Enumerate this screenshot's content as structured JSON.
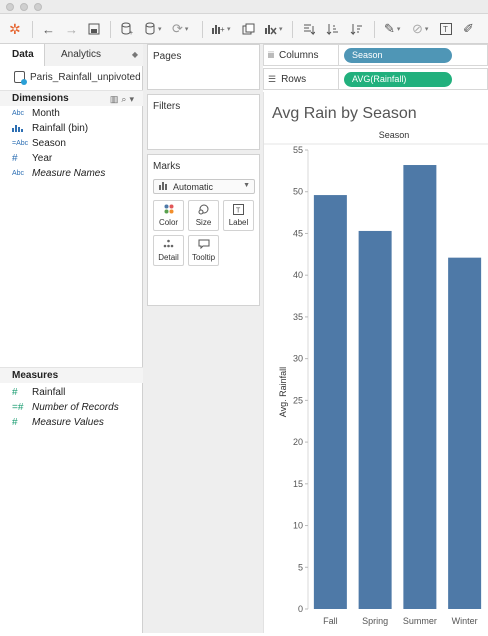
{
  "colors": {
    "bar": "#4e79a7",
    "columns_pill": "#4f96b6",
    "rows_pill": "#22b07d"
  },
  "toolbar": {
    "icons": [
      "tableau-logo-icon",
      "back-arrow-icon",
      "forward-arrow-icon",
      "save-icon",
      "new-datasource-icon",
      "pause-datasource-icon",
      "refresh-icon",
      "new-worksheet-icon",
      "duplicate-sheet-icon",
      "clear-sheet-icon",
      "swap-axes-icon",
      "sort-ascending-icon",
      "sort-descending-icon",
      "highlight-icon",
      "group-icon",
      "text-label-icon",
      "pin-icon"
    ]
  },
  "left_panel": {
    "tabs": {
      "data": "Data",
      "analytics": "Analytics"
    },
    "datasource": "Paris_Rainfall_unpivoted",
    "dimensions_title": "Dimensions",
    "dimensions": [
      {
        "type": "Abc",
        "name": "Month"
      },
      {
        "type": "bin",
        "name": "Rainfall (bin)"
      },
      {
        "type": "=Abc",
        "name": "Season"
      },
      {
        "type": "#",
        "name": "Year"
      },
      {
        "type": "Abc",
        "name": "Measure Names"
      }
    ],
    "measures_title": "Measures",
    "measures": [
      {
        "type": "#",
        "name": "Rainfall"
      },
      {
        "type": "=#",
        "name": "Number of Records"
      },
      {
        "type": "#",
        "name": "Measure Values"
      }
    ]
  },
  "cards": {
    "pages": "Pages",
    "filters": "Filters",
    "marks": "Marks",
    "mark_type": "Automatic",
    "buttons": {
      "color": "Color",
      "size": "Size",
      "label": "Label",
      "detail": "Detail",
      "tooltip": "Tooltip"
    }
  },
  "shelves": {
    "columns_label": "Columns",
    "columns_pill": "Season",
    "rows_label": "Rows",
    "rows_pill": "AVG(Rainfall)"
  },
  "chart_data": {
    "type": "bar",
    "title": "Avg Rain by Season",
    "column_header": "Season",
    "ylabel": "Avg. Rainfall",
    "xlabel": "",
    "categories": [
      "Fall",
      "Spring",
      "Summer",
      "Winter"
    ],
    "values": [
      49.6,
      45.3,
      53.2,
      42.1
    ],
    "ylim": [
      0,
      55
    ],
    "yticks": [
      0,
      5,
      10,
      15,
      20,
      25,
      30,
      35,
      40,
      45,
      50,
      55
    ],
    "grid": false,
    "legend": "none"
  }
}
